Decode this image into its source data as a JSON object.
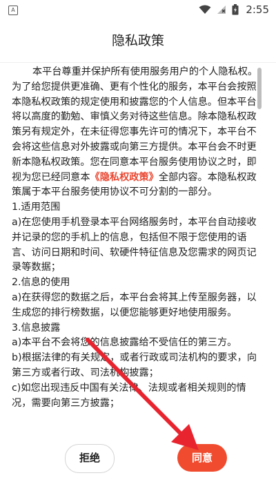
{
  "status_bar": {
    "app_icon_letter": "A",
    "time": "2:55",
    "icons": [
      "wifi-icon",
      "signal-icon",
      "battery-icon"
    ]
  },
  "header": {
    "title": "隐私政策"
  },
  "policy": {
    "intro_before_link": "本平台尊重并保护所有使用服务用户的个人隐私权。为了给您提供更准确、更有个性化的服务，本平台会按照本隐私权政策的规定使用和披露您的个人信息。但本平台将以高度的勤勉、审慎义务对待这些信息。除本隐私权政策另有规定外，在未征得您事先许可的情况下，本平台不会将这些信息对外披露或向第三方提供。本平台会不时更新本隐私权政策。您在同意本平台服务使用协议之时，即视为您已经同意本",
    "intro_link": "《隐私权政策》",
    "intro_after_link": "全部内容。本隐私权政策属于本平台服务使用协议不可分割的一部分。",
    "s1_title": "1.适用范围",
    "s1_a": "a)在您使用手机登录本平台网络服务时，本平台自动接收并记录的您的手机上的信息，包括但不限于您使用的语言、访问日期和时间、软硬件特征信息及您需求的网页记录等数据；",
    "s2_title": "2.信息的使用",
    "s2_a": "a)在获得您的数据之后，本平台会将其上传至服务器，以生成您的排行榜数据，以便您能够更好地使用服务。",
    "s3_title": "3.信息披露",
    "s3_a": "a)本平台不会将您的信息披露给不受信任的第三方。",
    "s3_b": "b)根据法律的有关规定，或者行政或司法机构的要求，向第三方或者行政、司法机构披露；",
    "s3_c": "c)如您出现违反中国有关法律、法规或者相关规则的情况，需要向第三方披露；"
  },
  "buttons": {
    "decline": "拒绝",
    "accept": "同意"
  },
  "colors": {
    "accent": "#f04b2e",
    "link": "#e94630",
    "arrow": "#e8242f"
  }
}
